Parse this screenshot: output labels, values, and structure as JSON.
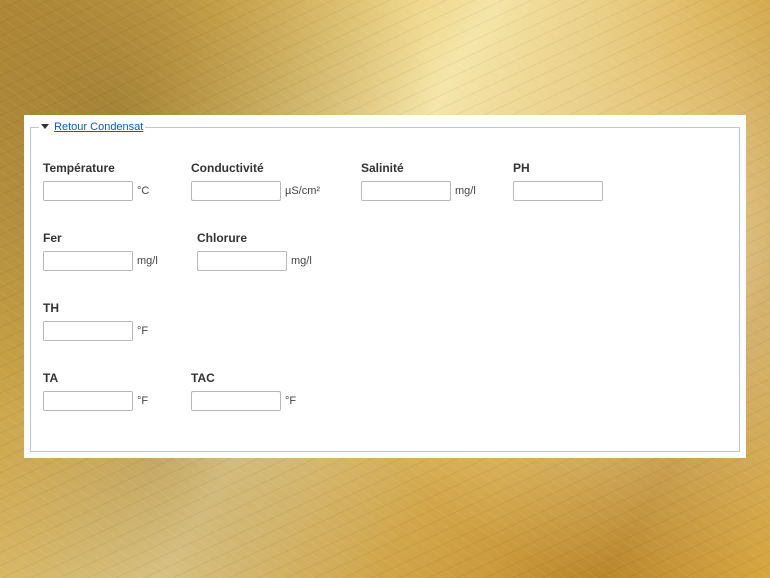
{
  "group": {
    "legend": "Retour Condensat"
  },
  "fields": {
    "temperature": {
      "label": "Température",
      "value": "",
      "unit": "°C"
    },
    "conductivite": {
      "label": "Conductivité",
      "value": "",
      "unit": "µS/cm²"
    },
    "salinite": {
      "label": "Salinité",
      "value": "",
      "unit": "mg/l"
    },
    "ph": {
      "label": "PH",
      "value": "",
      "unit": ""
    },
    "fer": {
      "label": "Fer",
      "value": "",
      "unit": "mg/l"
    },
    "chlorure": {
      "label": "Chlorure",
      "value": "",
      "unit": "mg/l"
    },
    "th": {
      "label": "TH",
      "value": "",
      "unit": "°F"
    },
    "ta": {
      "label": "TA",
      "value": "",
      "unit": "°F"
    },
    "tac": {
      "label": "TAC",
      "value": "",
      "unit": "°F"
    }
  }
}
